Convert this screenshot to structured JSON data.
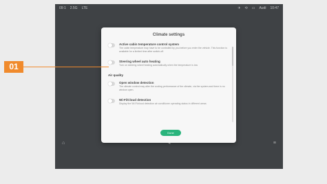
{
  "statusbar": {
    "left_items": [
      "09:1",
      "2.5G",
      "LTE"
    ],
    "right_items": [
      "✈",
      "⟲",
      "▭",
      "Audi",
      "10:47"
    ]
  },
  "dialog": {
    "title": "Climate settings",
    "options": [
      {
        "title": "Active cabin temperature control system",
        "desc": "The cabin temperature may have to be controlled by you before you enter the vehicle. This function is available for a limited time after switch-off."
      },
      {
        "title": "Steering wheel auto heating",
        "desc": "Turn on steering wheel heating automatically when the temperature is low"
      }
    ],
    "section_label": "Air quality",
    "options2": [
      {
        "title": "Open window detection",
        "desc": "The climate control may alter the cooling performance of the climate, via the system and there is no window open."
      },
      {
        "title": "Wi-Fi/Cloud detection",
        "desc": "Display the Wi-Fi/cloud detection air conditioner operating status in different areas"
      }
    ],
    "done_label": "Done"
  },
  "marker": {
    "label": "01",
    "color": "#f08a2c"
  },
  "colors": {
    "accent": "#2ab47c",
    "screen_bg": "#3f4245"
  }
}
